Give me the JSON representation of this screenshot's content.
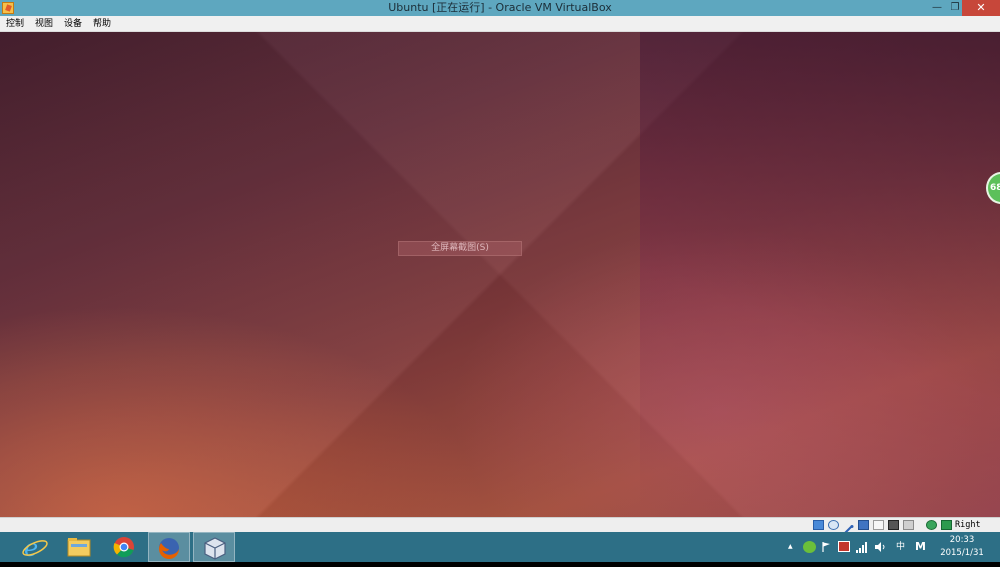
{
  "window": {
    "title": "Ubuntu [正在运行] - Oracle VM VirtualBox",
    "minimize_glyph": "—",
    "restore_glyph": "❐",
    "close_glyph": "✕"
  },
  "menu": {
    "items": [
      {
        "label": "控制"
      },
      {
        "label": "视图"
      },
      {
        "label": "设备"
      },
      {
        "label": "帮助"
      }
    ]
  },
  "vm": {
    "tooltip": "全屏幕截图(S)",
    "badge_text": "68"
  },
  "statusbar": {
    "host_key": "Right Ctrl",
    "icons": [
      "hard-disk-icon",
      "optical-drive-icon",
      "usb-icon",
      "network-icon",
      "shared-folders-icon",
      "display-icon",
      "video-capture-icon",
      "mouse-integration-icon",
      "keyboard-capture-icon"
    ]
  },
  "taskbar": {
    "apps": [
      "internet-explorer-icon",
      "file-explorer-icon",
      "chrome-icon",
      "firefox-icon",
      "virtualbox-icon"
    ],
    "tray": {
      "up_arrow": "▲",
      "ime": "中",
      "m_label": "M"
    },
    "clock": {
      "time": "20:33",
      "date": "2015/1/31"
    }
  },
  "colors": {
    "titlebar": "#5ea7bf",
    "taskbar": "#2d6f86",
    "close_button": "#c7473a"
  }
}
